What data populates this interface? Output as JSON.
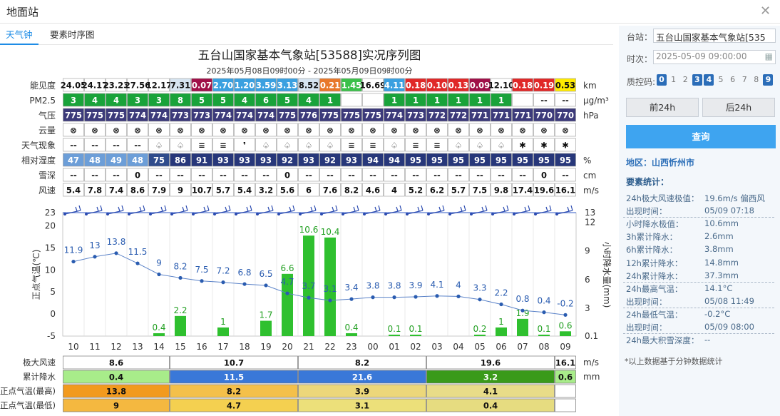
{
  "header": {
    "title": "地面站",
    "close": "✕"
  },
  "tabs": [
    {
      "label": "天气钟"
    },
    {
      "label": "要素时序图"
    }
  ],
  "chart_title": "五台山国家基本气象站[53588]实况序列图",
  "chart_subtitle": "2025年05月08日09时00分 - 2025年05月09日09时00分",
  "table": {
    "rows": [
      {
        "label": "能见度",
        "unit": "km",
        "values": [
          "24.05",
          "24.17",
          "23.23",
          "27.56",
          "12.17",
          "7.31",
          "0.07",
          "2.70",
          "1.20",
          "3.59",
          "3.13",
          "8.52",
          "0.21",
          "1.45",
          "16.69",
          "4.11",
          "0.18",
          "0.10",
          "0.13",
          "0.09",
          "12.10",
          "0.18",
          "0.19",
          "0.53"
        ],
        "colors": [
          "#fff",
          "#fff",
          "#fff",
          "#fff",
          "#fff",
          "#d6e4f0",
          "#a01048",
          "#3aa0e0",
          "#3aa0e0",
          "#3aa0e0",
          "#3aa0e0",
          "#d6e4f0",
          "#e8782a",
          "#3bc04a",
          "#fff",
          "#3aa0e0",
          "#e02828",
          "#e02828",
          "#e02828",
          "#a01048",
          "#fff",
          "#e02828",
          "#e02828",
          "#ffea00"
        ]
      },
      {
        "label": "PM2.5",
        "unit": "μg/m³",
        "values": [
          "3",
          "4",
          "4",
          "3",
          "3",
          "8",
          "5",
          "5",
          "4",
          "6",
          "5",
          "4",
          "1",
          "",
          "",
          "1",
          "1",
          "1",
          "1",
          "1",
          "1",
          "",
          "--",
          "--"
        ],
        "bg": "#19a33a"
      },
      {
        "label": "气压",
        "unit": "hPa",
        "values": [
          "775",
          "775",
          "775",
          "774",
          "774",
          "773",
          "773",
          "774",
          "774",
          "774",
          "775",
          "776",
          "775",
          "775",
          "775",
          "774",
          "773",
          "772",
          "772",
          "771",
          "771",
          "771",
          "770",
          "770"
        ],
        "bg": "#3c3a7a"
      },
      {
        "label": "云量",
        "unit": "",
        "values": [
          "⊗",
          "⊗",
          "⊗",
          "⊗",
          "⊗",
          "⊗",
          "⊗",
          "⊗",
          "⊗",
          "⊗",
          "⊗",
          "⊗",
          "⊗",
          "⊗",
          "⊗",
          "⊗",
          "⊗",
          "⊗",
          "⊗",
          "⊗",
          "⊗",
          "⊗",
          "⊗",
          "⊗"
        ]
      },
      {
        "label": "天气现象",
        "unit": "",
        "values": [
          "--",
          "--",
          "--",
          "--",
          "♤",
          "♤",
          "≡",
          "≡",
          "❜",
          "♤",
          "♤",
          "♤",
          "♤",
          "≡",
          "≡",
          "♤",
          "≡",
          "≡",
          "♤",
          "♤",
          "♤",
          "✱",
          "✱",
          "✱"
        ]
      },
      {
        "label": "相对湿度",
        "unit": "%",
        "values": [
          "47",
          "48",
          "49",
          "48",
          "75",
          "86",
          "91",
          "93",
          "93",
          "93",
          "92",
          "93",
          "92",
          "93",
          "94",
          "94",
          "95",
          "95",
          "95",
          "95",
          "95",
          "95",
          "95",
          "95"
        ],
        "colors": [
          "#6c9ed8",
          "#6c9ed8",
          "#6c9ed8",
          "#6c9ed8",
          "#2f4c8c",
          "#27377a",
          "#27377a",
          "#27377a",
          "#27377a",
          "#27377a",
          "#27377a",
          "#27377a",
          "#27377a",
          "#27377a",
          "#27377a",
          "#27377a",
          "#27377a",
          "#27377a",
          "#27377a",
          "#27377a",
          "#27377a",
          "#27377a",
          "#27377a",
          "#27377a"
        ]
      },
      {
        "label": "雪深",
        "unit": "cm",
        "values": [
          "--",
          "--",
          "--",
          "0",
          "--",
          "--",
          "--",
          "--",
          "--",
          "--",
          "0",
          "--",
          "--",
          "--",
          "--",
          "--",
          "--",
          "--",
          "--",
          "--",
          "--",
          "--",
          "0",
          "--"
        ]
      },
      {
        "label": "风速",
        "unit": "m/s",
        "values": [
          "5.4",
          "7.8",
          "7.4",
          "8.6",
          "7.9",
          "9",
          "10.7",
          "5.7",
          "5.4",
          "3.2",
          "5.6",
          "6",
          "7.6",
          "8.2",
          "4.6",
          "4",
          "5.2",
          "6.2",
          "5.7",
          "7.5",
          "9.8",
          "17.4",
          "19.6",
          "16.1"
        ]
      }
    ]
  },
  "chart_data": {
    "type": "bar",
    "categories": [
      "10",
      "11",
      "12",
      "13",
      "14",
      "15",
      "16",
      "17",
      "18",
      "19",
      "20",
      "21",
      "22",
      "23",
      "00",
      "01",
      "02",
      "03",
      "04",
      "05",
      "06",
      "07",
      "08",
      "09"
    ],
    "series": [
      {
        "name": "",
        "type": "line",
        "values": [
          11.9,
          13,
          13.8,
          11.5,
          9,
          8.2,
          7.5,
          7.2,
          6.8,
          6.5,
          4.7,
          3.7,
          3.1,
          3.4,
          3.8,
          3.8,
          3.9,
          4.1,
          4,
          3.3,
          2.2,
          0.8,
          0.4,
          -0.2
        ]
      },
      {
        "name": "",
        "type": "bar",
        "values": [
          null,
          null,
          null,
          null,
          0.4,
          2.2,
          null,
          1,
          null,
          1.7,
          6.6,
          10.6,
          10.4,
          0.4,
          null,
          0.1,
          0.1,
          null,
          null,
          0.2,
          1,
          1.9,
          0.1,
          0.6
        ]
      }
    ],
    "ylabel_left": "正点气温(℃)",
    "ylabel_right": "小时降水量(mm)",
    "y_left_ticks": [
      "23",
      "20",
      "15",
      "10",
      "5",
      "0",
      "-5"
    ],
    "y_right_ticks": [
      "13",
      "12",
      "9",
      "6",
      "3",
      "0.1"
    ],
    "ylim_left": [
      -5,
      23
    ],
    "ylim_right": [
      0.1,
      13
    ]
  },
  "summary": {
    "groups": [
      "8.6",
      "10.7",
      "8.2",
      "19.6",
      "16.1"
    ],
    "rows": [
      {
        "label": "极大风速",
        "unit": "m/s",
        "values": [
          "8.6",
          "10.7",
          "8.2",
          "19.6",
          "16.1"
        ]
      },
      {
        "label": "累计降水",
        "unit": "mm",
        "values": [
          "0.4",
          "11.5",
          "21.6",
          "3.2",
          "0.6"
        ],
        "colors": [
          "#a8ec8a",
          "#3a78d8",
          "#3a78d8",
          "#3a9a1a",
          "#a8ec8a"
        ]
      },
      {
        "label": "正点气温(最高)",
        "unit": "",
        "values": [
          "13.8",
          "8.2",
          "3.9",
          "4.1",
          ""
        ],
        "colors": [
          "#f29a1e",
          "#f4c04a",
          "#ecd77a",
          "#e8dc88",
          "#fff"
        ]
      },
      {
        "label": "正点气温(最低)",
        "unit": "",
        "values": [
          "9",
          "4.7",
          "3.1",
          "0.4",
          ""
        ],
        "colors": [
          "#f4b840",
          "#f4d050",
          "#ece07a",
          "#e6dc80",
          "#fff"
        ]
      }
    ]
  },
  "sidebar": {
    "station_label": "台站：",
    "station_value": "五台山国家基本气象站[535",
    "time_label": "时次：",
    "time_value": "2025-05-09 09:00:00",
    "qc_label": "质控码:",
    "qc": [
      "0",
      "1",
      "2",
      "3",
      "4",
      "5",
      "6",
      "7",
      "8",
      "9"
    ],
    "qc_on": [
      0,
      3,
      4,
      9
    ],
    "prev_btn": "前24h",
    "next_btn": "后24h",
    "query_btn": "查询",
    "region": "地区：山西忻州市",
    "stats_title": "要素统计：",
    "stats": [
      {
        "k": "24h极大风速极值：",
        "v": "19.6m/s 偏西风"
      },
      {
        "k": "出现时间：",
        "v": "05/09 07:18"
      },
      {
        "k": "小时降水极值：",
        "v": "10.6mm"
      },
      {
        "k": "3h累计降水：",
        "v": "2.6mm"
      },
      {
        "k": "6h累计降水：",
        "v": "3.8mm"
      },
      {
        "k": "12h累计降水：",
        "v": "14.8mm"
      },
      {
        "k": "24h累计降水：",
        "v": "37.3mm"
      },
      {
        "k": "24h最高气温：",
        "v": "14.1°C"
      },
      {
        "k": "出现时间：",
        "v": "05/08 11:49"
      },
      {
        "k": "24h最低气温：",
        "v": "-0.2°C"
      },
      {
        "k": "出现时间：",
        "v": "05/09 08:00"
      },
      {
        "k": "24h最大积雪深度：",
        "v": "--"
      }
    ],
    "note": "*以上数据基于分钟数据统计"
  }
}
